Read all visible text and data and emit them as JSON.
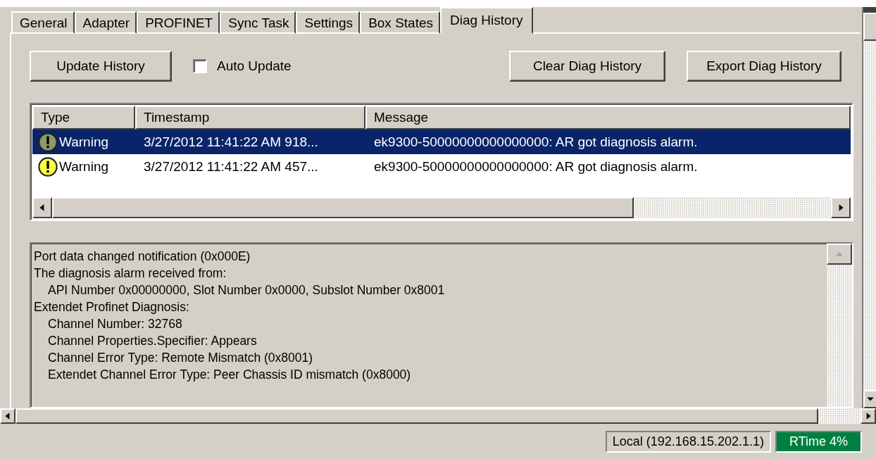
{
  "tabs": [
    {
      "label": "General",
      "selected": false
    },
    {
      "label": "Adapter",
      "selected": false
    },
    {
      "label": "PROFINET",
      "selected": false
    },
    {
      "label": "Sync Task",
      "selected": false
    },
    {
      "label": "Settings",
      "selected": false
    },
    {
      "label": "Box States",
      "selected": false
    },
    {
      "label": "Diag History",
      "selected": true
    }
  ],
  "update_button": "Update History",
  "auto_update": {
    "label": "Auto Update",
    "checked": false
  },
  "clear_button": "Clear Diag History",
  "export_button": "Export Diag History",
  "history_table": {
    "columns": [
      "Type",
      "Timestamp",
      "Message"
    ],
    "rows": [
      {
        "type": "Warning",
        "timestamp": "3/27/2012 11:41:22 AM 918...",
        "message": "ek9300-50000000000000000: AR got diagnosis alarm.",
        "selected": true
      },
      {
        "type": "Warning",
        "timestamp": "3/27/2012 11:41:22 AM 457...",
        "message": "ek9300-50000000000000000: AR got diagnosis alarm.",
        "selected": false
      }
    ]
  },
  "details": [
    {
      "text": "Port data changed notification (0x000E)"
    },
    {
      "text": "The diagnosis alarm received from:",
      "children": [
        {
          "text": "API Number 0x00000000, Slot Number 0x0000, Subslot Number 0x8001"
        }
      ]
    },
    {
      "text": "Extendet Profinet Diagnosis:",
      "children": [
        {
          "text": "Channel Number: 32768"
        },
        {
          "text": "Channel Properties.Specifier: Appears"
        },
        {
          "text": "Channel Error Type: Remote Mismatch (0x8001)"
        },
        {
          "text": "Extendet Channel Error Type: Peer Chassis ID mismatch (0x8000)"
        }
      ]
    }
  ],
  "status_bar": {
    "connection": "Local (192.168.15.202.1.1)",
    "rtime": "RTime 4%"
  }
}
